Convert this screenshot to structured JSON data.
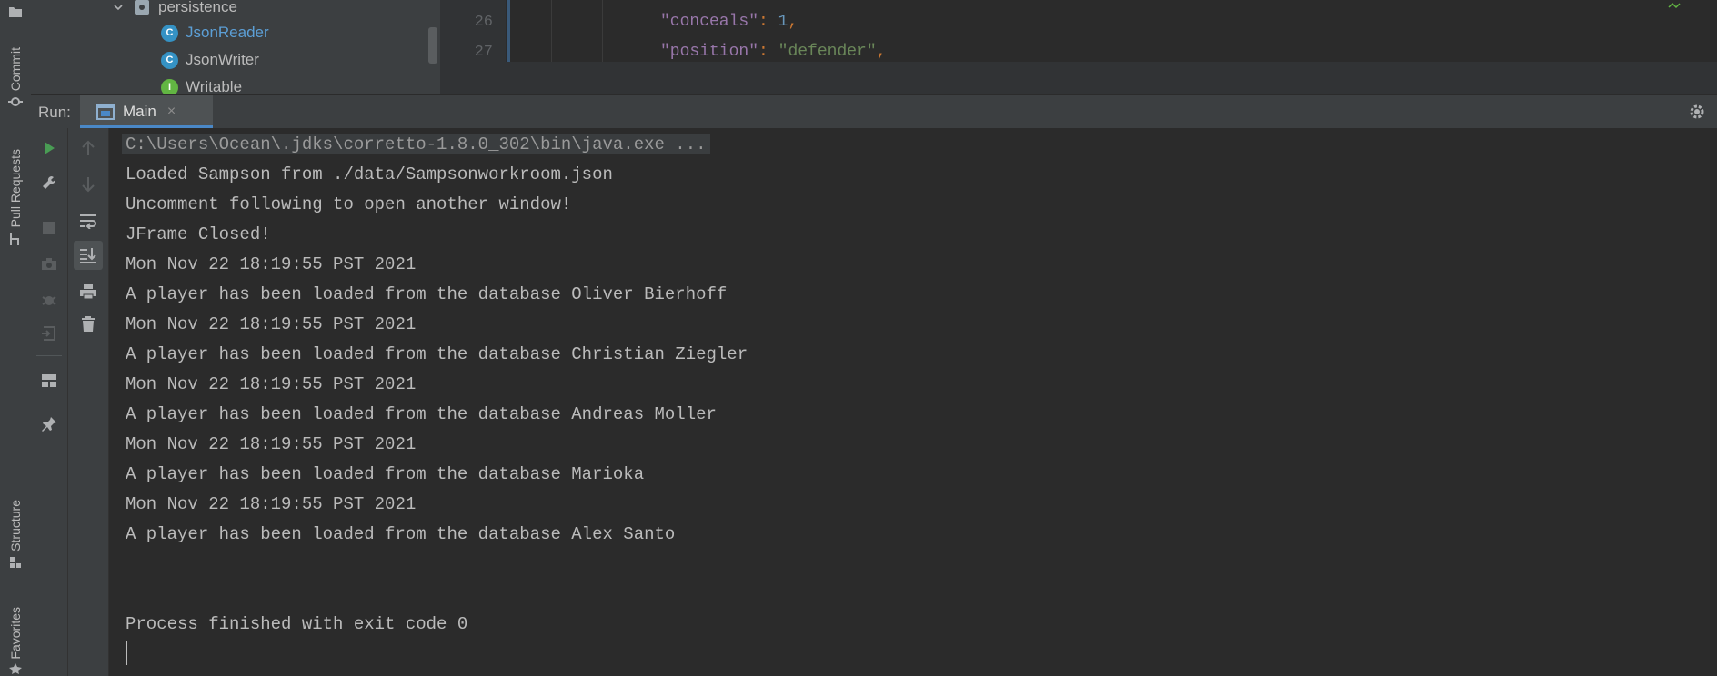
{
  "left_strip": {
    "tabs": [
      {
        "label": "Commit",
        "icon": "commit-icon"
      },
      {
        "label": "Pull Requests",
        "icon": "pull-requests-icon"
      },
      {
        "label": "Structure",
        "icon": "structure-icon"
      },
      {
        "label": "Favorites",
        "icon": "favorites-icon"
      }
    ]
  },
  "project_tree": {
    "items": [
      {
        "label": "persistence",
        "kind": "package"
      },
      {
        "label": "JsonReader",
        "kind": "class",
        "badge": "C"
      },
      {
        "label": "JsonWriter",
        "kind": "class",
        "badge": "C"
      },
      {
        "label": "Writable",
        "kind": "interface",
        "badge": "I"
      }
    ]
  },
  "editor": {
    "lines": [
      {
        "number": "26",
        "key": "\"conceals\"",
        "colon": ": ",
        "value": "1",
        "value_type": "number",
        "trail": ","
      },
      {
        "number": "27",
        "key": "\"position\"",
        "colon": ": ",
        "value": "\"defender\"",
        "value_type": "string",
        "trail": ","
      }
    ]
  },
  "run_panel": {
    "label": "Run:",
    "tab": {
      "label": "Main",
      "close": "×"
    },
    "settings_icon": "gear-icon"
  },
  "toolbar": {
    "primary": [
      "run-icon",
      "wrench-icon",
      "stop-icon",
      "camera-icon",
      "debug-icon",
      "exit-icon",
      "layout-icon",
      "pin-icon"
    ],
    "secondary": [
      "arrow-up-icon",
      "arrow-down-icon",
      "soft-wrap-icon",
      "scroll-to-end-icon",
      "print-icon",
      "trash-icon"
    ]
  },
  "console": {
    "command": "C:\\Users\\Ocean\\.jdks\\corretto-1.8.0_302\\bin\\java.exe ...",
    "lines": [
      "Loaded Sampson from ./data/Sampsonworkroom.json",
      "Uncomment following to open another window!",
      "JFrame Closed!",
      "Mon Nov 22 18:19:55 PST 2021",
      "A player has been loaded from the database Oliver Bierhoff",
      "Mon Nov 22 18:19:55 PST 2021",
      "A player has been loaded from the database Christian Ziegler",
      "Mon Nov 22 18:19:55 PST 2021",
      "A player has been loaded from the database Andreas Moller",
      "Mon Nov 22 18:19:55 PST 2021",
      "A player has been loaded from the database Marioka",
      "Mon Nov 22 18:19:55 PST 2021",
      "A player has been loaded from the database Alex Santo"
    ],
    "exit_message": "Process finished with exit code 0"
  },
  "colors": {
    "accent": "#4a88c7",
    "run_green": "#499c54",
    "class_icon": "#3592c4",
    "interface_icon": "#62b543"
  }
}
